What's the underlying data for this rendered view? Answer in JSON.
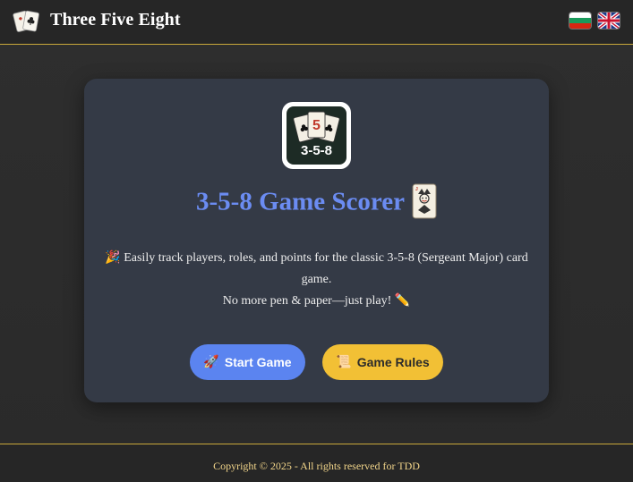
{
  "header": {
    "app_title": "Three Five Eight",
    "logo_icon": "playing-cards-icon",
    "languages": [
      {
        "code": "bg",
        "icon": "bulgarian-flag-icon"
      },
      {
        "code": "en",
        "icon": "uk-flag-icon"
      }
    ]
  },
  "card": {
    "logo_text": "3-5-8",
    "logo_card_value": "5",
    "title": "3-5-8 Game Scorer",
    "title_icon": "joker-card-icon",
    "description_line1": "🎉 Easily track players, roles, and points for the classic 3-5-8 (Sergeant Major) card game.",
    "description_line2": "No more pen & paper—just play! ✏️",
    "start_button": {
      "icon": "🚀",
      "label": "Start Game"
    },
    "rules_button": {
      "icon": "📜",
      "label": "Game Rules"
    }
  },
  "footer": {
    "copyright": "Copyright © 2025 - All rights reserved for TDD"
  },
  "colors": {
    "accent_blue": "#5b84f0",
    "title_blue": "#6b8cf2",
    "accent_yellow": "#f2c035",
    "gold_border": "#c9a83a",
    "card_bg": "#343a46"
  }
}
